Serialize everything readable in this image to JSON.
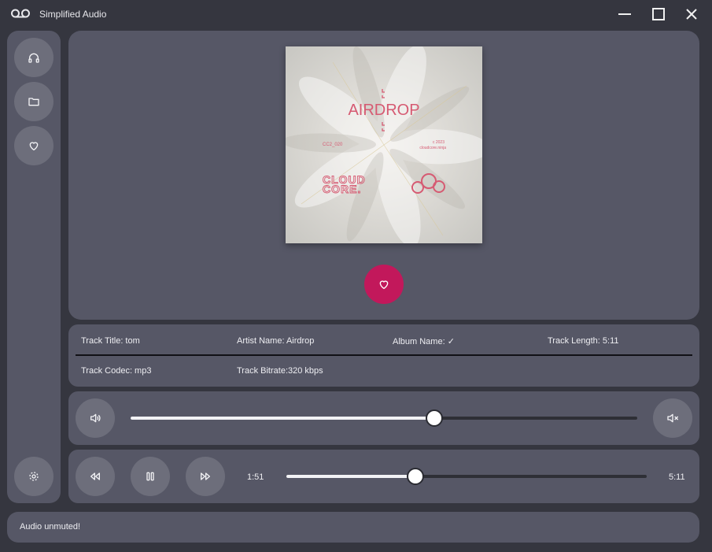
{
  "app": {
    "title": "Simplified Audio"
  },
  "sidebar": {
    "items": [
      {
        "name": "now-playing",
        "icon": "headphones-icon"
      },
      {
        "name": "library",
        "icon": "folder-icon"
      },
      {
        "name": "favorites",
        "icon": "heart-icon"
      }
    ],
    "settings_icon": "gear-icon"
  },
  "album_art": {
    "title": "AIRDROP",
    "catalog": "CC2_020",
    "label_line1": "c 2023",
    "label_line2": "cloudcore.ninja",
    "logo_line1": "CLOUD",
    "logo_line2": "CORE."
  },
  "track_info": {
    "title": "Track Title: tom",
    "artist": "Artist Name: Airdrop",
    "album": "Album Name: ✓",
    "length": "Track Length: 5:11",
    "codec": "Track Codec: mp3",
    "bitrate": "Track Bitrate:320 kbps"
  },
  "volume": {
    "level": 0.6
  },
  "playback": {
    "elapsed": "1:51",
    "total": "5:11",
    "progress": 0.357
  },
  "status": {
    "message": "Audio unmuted!"
  },
  "colors": {
    "accent": "#c2185b",
    "panel": "#565766",
    "background": "#35363f"
  }
}
